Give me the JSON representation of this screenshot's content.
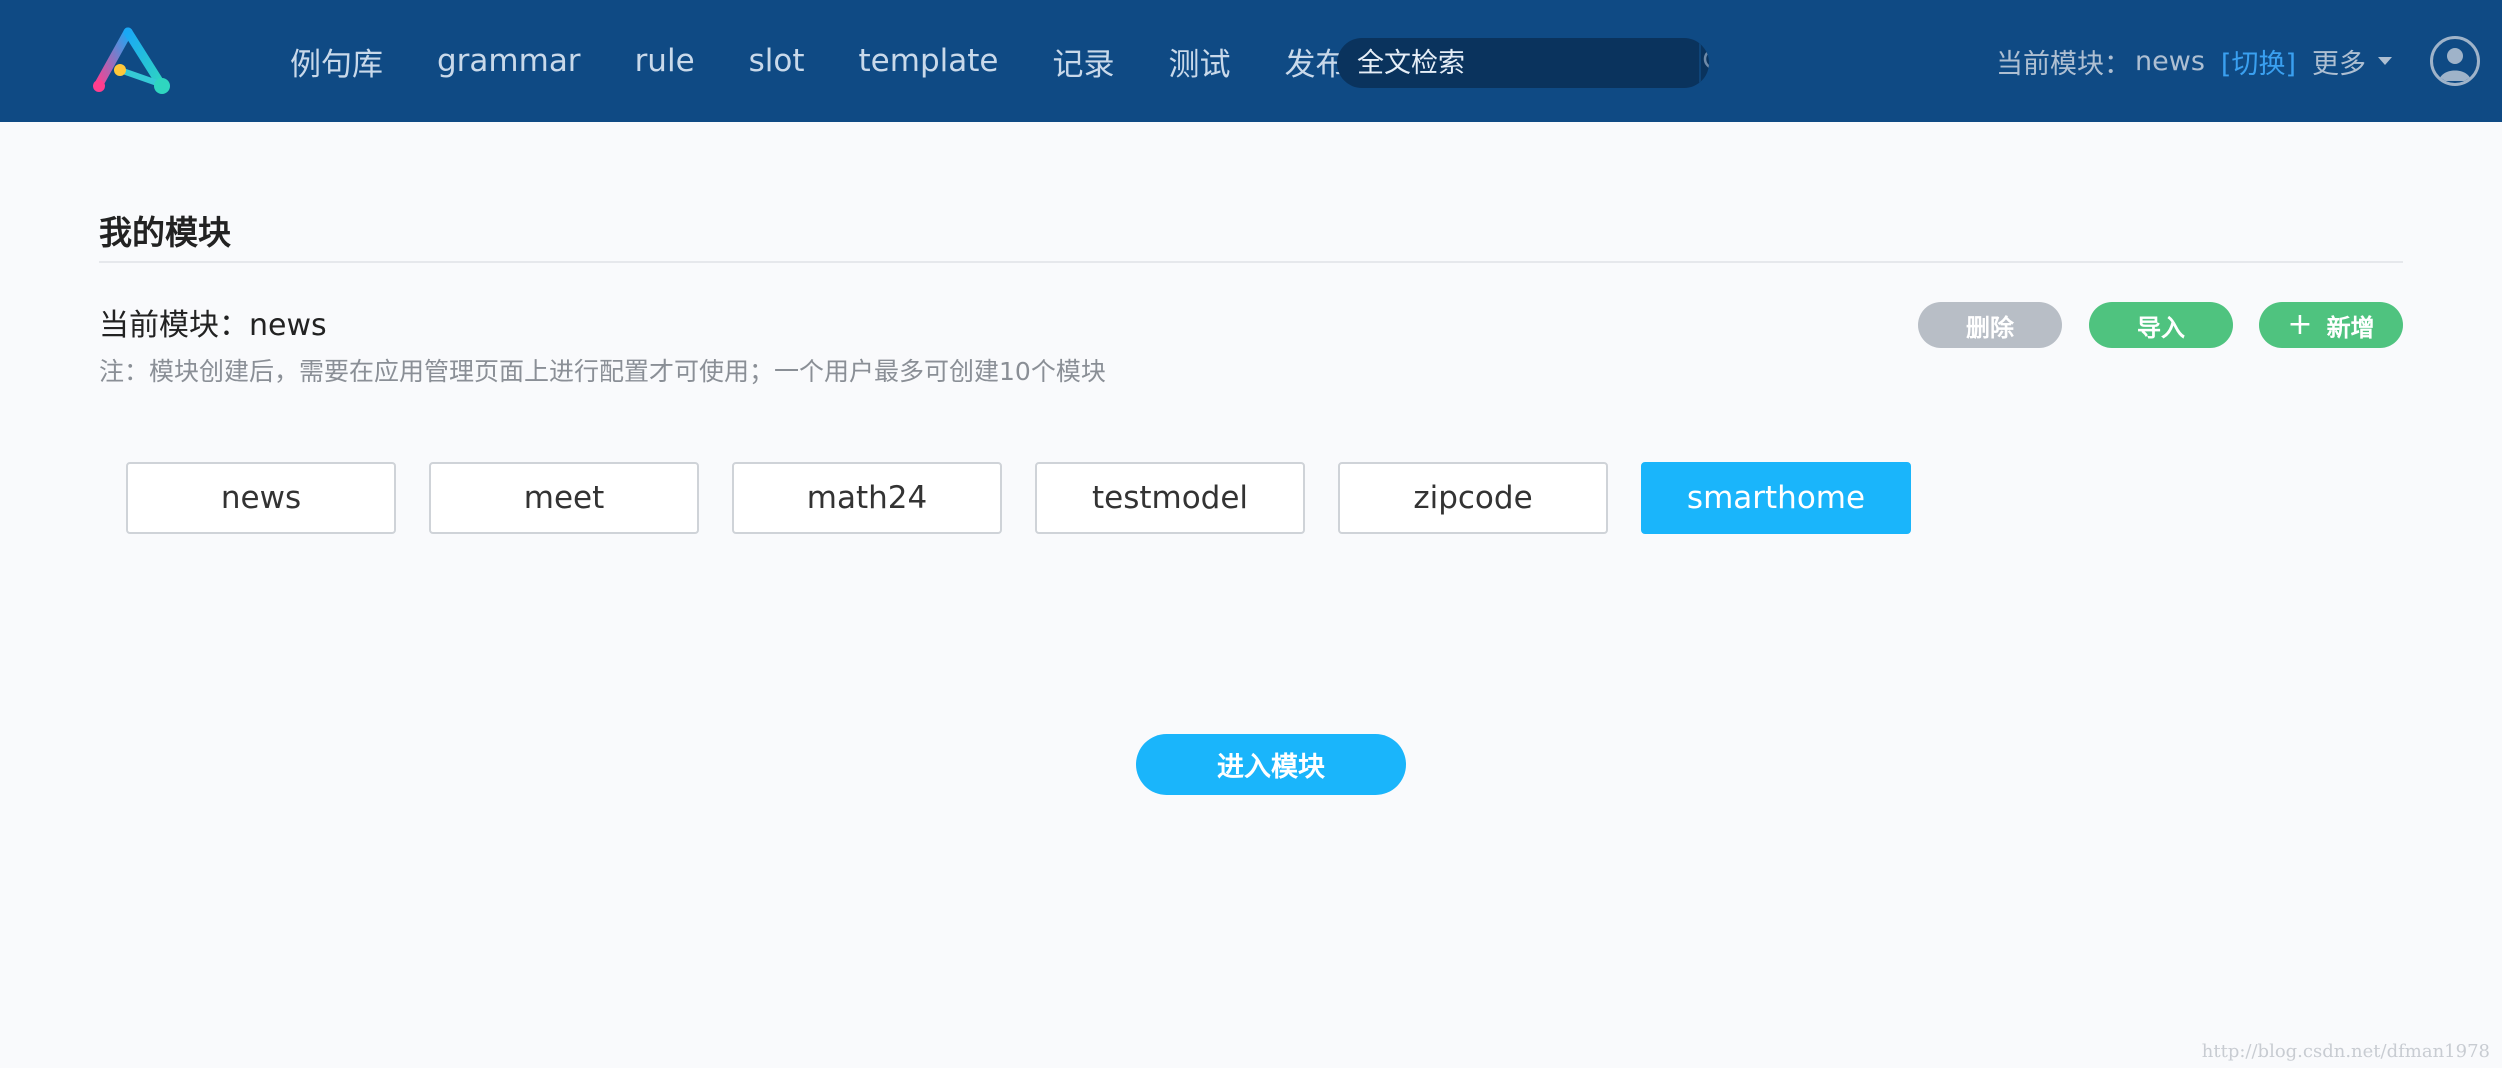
{
  "header": {
    "nav": [
      "例句库",
      "grammar",
      "rule",
      "slot",
      "template",
      "记录",
      "测试",
      "发布"
    ],
    "search": {
      "placeholder": "全文检索",
      "value": ""
    },
    "current_module_label": "当前模块：",
    "current_module_value": "news",
    "switch_label": "[切换]",
    "more_label": "更多"
  },
  "main": {
    "section_title": "我的模块",
    "current_module_line": "当前模块：news",
    "note": "注：模块创建后，需要在应用管理页面上进行配置才可使用；一个用户最多可创建10个模块",
    "actions": {
      "delete": "删除",
      "import": "导入",
      "add": "新增"
    },
    "modules": [
      "news",
      "meet",
      "math24",
      "testmodel",
      "zipcode",
      "smarthome"
    ],
    "selected_module": "smarthome",
    "enter_label": "进入模块"
  },
  "watermark": "http://blog.csdn.net/dfman1978",
  "colors": {
    "header_bg": "#0f4a84",
    "accent_blue": "#1ab5fb",
    "green": "#4fc37f",
    "gray_button": "#b8bec6",
    "link_blue": "#3aa0f0"
  },
  "icons": [
    "app-logo-icon",
    "search-icon",
    "chevron-down-icon",
    "user-avatar-icon",
    "plus-icon"
  ]
}
